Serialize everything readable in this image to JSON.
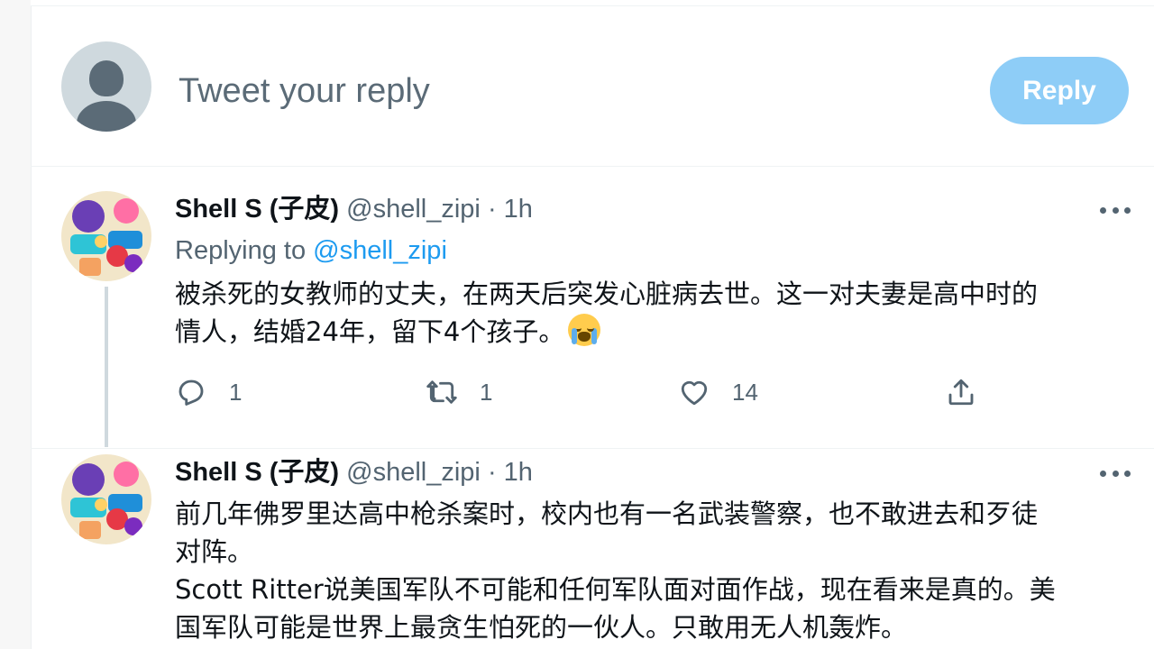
{
  "compose": {
    "placeholder": "Tweet your reply",
    "reply_button": "Reply"
  },
  "tweets": [
    {
      "name": "Shell S (子皮)",
      "handle": "@shell_zipi",
      "separator": "·",
      "time": "1h",
      "replying_prefix": "Replying to",
      "replying_to": "@shell_zipi",
      "text_lines": [
        "被杀死的女教师的丈夫，在两天后突发心脏病去世。这一对夫妻是高中时的",
        "情人，结婚24年，留下4个孩子。"
      ],
      "emoji": "loudly-crying-face",
      "replies": "1",
      "retweets": "1",
      "likes": "14"
    },
    {
      "name": "Shell S (子皮)",
      "handle": "@shell_zipi",
      "separator": "·",
      "time": "1h",
      "text_lines": [
        "前几年佛罗里达高中枪杀案时，校内也有一名武装警察，也不敢进去和歹徒",
        "对阵。",
        "Scott Ritter说美国军队不可能和任何军队面对面作战，现在看来是真的。美",
        "国军队可能是世界上最贪生怕死的一伙人。只敢用无人机轰炸。"
      ]
    }
  ],
  "icons": {
    "reply": "reply-icon",
    "retweet": "retweet-icon",
    "like": "heart-icon",
    "share": "share-icon",
    "more": "more-icon"
  },
  "colors": {
    "accent": "#1d9bf0",
    "reply_button_disabled": "#8ecdf7",
    "secondary_text": "#536471"
  }
}
